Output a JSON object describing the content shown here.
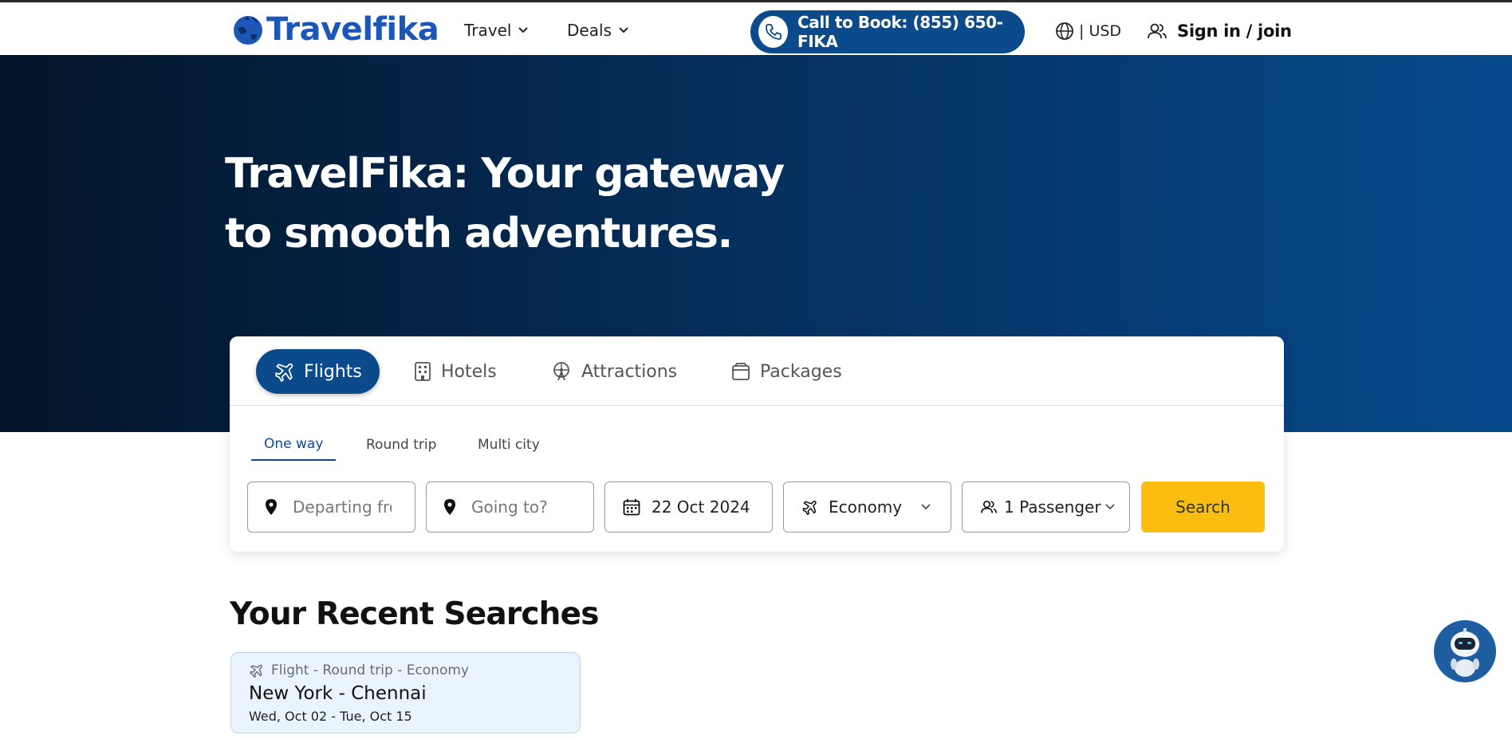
{
  "header": {
    "logo_text": "Travelfika",
    "nav": [
      {
        "label": "Travel",
        "icon": "chevron-down-icon"
      },
      {
        "label": "Deals",
        "icon": "chevron-down-icon"
      }
    ],
    "call_to_book": "Call to Book: (855) 650-FIKA",
    "currency": "| USD",
    "sign_in": "Sign in / join"
  },
  "hero": {
    "title_line1": "TravelFika: Your gateway",
    "title_line2": "to smooth adventures."
  },
  "search_widget": {
    "tabs": [
      {
        "label": "Flights",
        "icon": "airplane-icon",
        "active": true
      },
      {
        "label": "Hotels",
        "icon": "building-icon",
        "active": false
      },
      {
        "label": "Attractions",
        "icon": "ferris-wheel-icon",
        "active": false
      },
      {
        "label": "Packages",
        "icon": "package-icon",
        "active": false
      }
    ],
    "trip_types": [
      {
        "label": "One way",
        "active": true
      },
      {
        "label": "Round trip",
        "active": false
      },
      {
        "label": "Multi city",
        "active": false
      }
    ],
    "departing_placeholder": "Departing from",
    "going_placeholder": "Going to?",
    "date": "22 Oct 2024",
    "cabin_class": "Economy",
    "passengers": "1 Passenger",
    "search_label": "Search"
  },
  "recent_searches": {
    "title": "Your Recent Searches",
    "items": [
      {
        "type": "Flight - Round trip - Economy",
        "route": "New York - Chennai",
        "dates": "Wed, Oct 02 - Tue, Oct 15"
      }
    ]
  },
  "colors": {
    "brand_blue": "#0b4a8b",
    "logo_blue": "#1c57b8",
    "search_yellow": "#fbbd0f",
    "recent_card_bg": "#e9f4fe"
  }
}
